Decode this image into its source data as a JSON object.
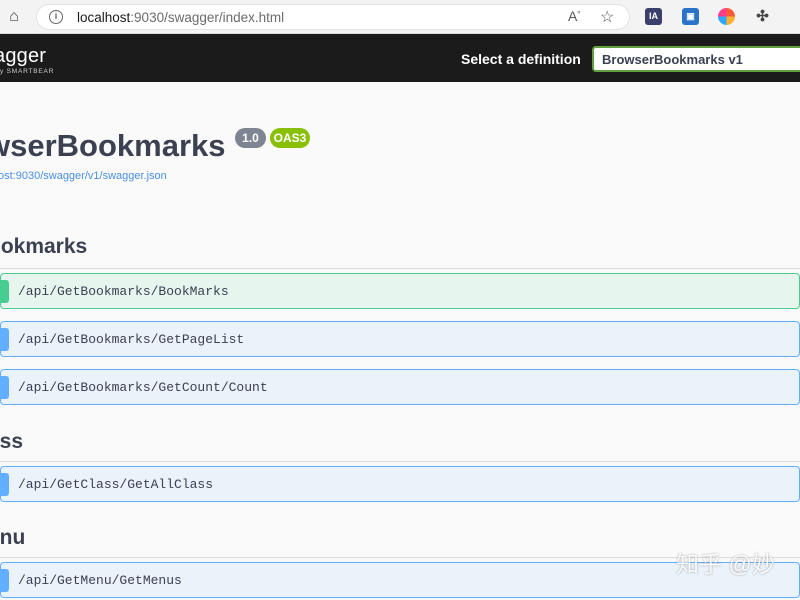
{
  "browser": {
    "url_host": "localhost",
    "url_path": ":9030/swagger/index.html",
    "read_aloud_label": "A",
    "ia_label": "IA"
  },
  "topbar": {
    "logo_text": "agger",
    "logo_sub": "y SMARTBEAR",
    "select_label": "Select a definition",
    "selected_definition": "BrowserBookmarks v1"
  },
  "info": {
    "title": "wserBookmarks",
    "version": "1.0",
    "oas": "OAS3",
    "spec_link": "ost:9030/swagger/v1/swagger.json"
  },
  "sections": [
    {
      "name": "ookmarks",
      "operations": [
        {
          "method": "post",
          "path": "/api/GetBookmarks/BookMarks"
        },
        {
          "method": "get",
          "path": "/api/GetBookmarks/GetPageList"
        },
        {
          "method": "get",
          "path": "/api/GetBookmarks/GetCount/Count"
        }
      ]
    },
    {
      "name": "ass",
      "operations": [
        {
          "method": "get",
          "path": "/api/GetClass/GetAllClass"
        }
      ]
    },
    {
      "name": "enu",
      "operations": [
        {
          "method": "get",
          "path": "/api/GetMenu/GetMenus"
        }
      ]
    }
  ],
  "watermark": "知乎 @妙"
}
